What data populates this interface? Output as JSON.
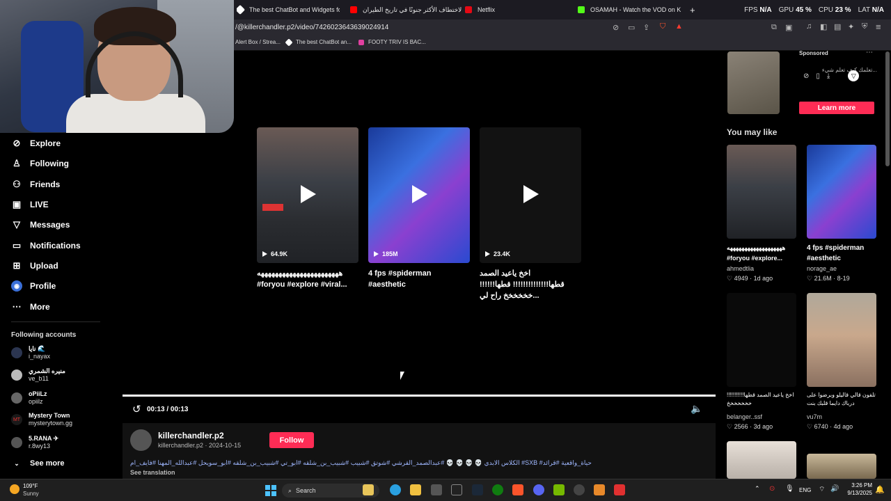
{
  "browser": {
    "tabs": [
      {
        "label": "The best ChatBot and Widgets for Ki",
        "color": "#ffffff"
      },
      {
        "label": "الاختطاف الأكثر جنونًا في تاريخ الطيران",
        "color": "#ff0000"
      },
      {
        "label": "Netflix",
        "color": "#e50914"
      },
      {
        "label": "OSAMAH - Watch the VOD on Kick",
        "color": "#53fc18"
      }
    ],
    "new_tab": "+",
    "url": "/@killerchandler.p2/video/7426023643639024914",
    "bookmarks": [
      "Alert Box / Strea...",
      "The best ChatBot an...",
      "FOOTY TRIV IS BAC..."
    ]
  },
  "overlay_stats": [
    {
      "label": "FPS",
      "value": "N/A"
    },
    {
      "label": "GPU",
      "value": "45 %"
    },
    {
      "label": "CPU",
      "value": "23 %"
    },
    {
      "label": "LAT",
      "value": "N/A"
    }
  ],
  "nav": [
    {
      "label": "Explore",
      "icon": "compass-icon"
    },
    {
      "label": "Following",
      "icon": "person-follow-icon"
    },
    {
      "label": "Friends",
      "icon": "friends-icon"
    },
    {
      "label": "LIVE",
      "icon": "live-tv-icon"
    },
    {
      "label": "Messages",
      "icon": "messages-icon"
    },
    {
      "label": "Notifications",
      "icon": "notifications-icon"
    },
    {
      "label": "Upload",
      "icon": "upload-icon"
    },
    {
      "label": "Profile",
      "icon": "profile-icon"
    },
    {
      "label": "More",
      "icon": "more-dots-icon"
    }
  ],
  "following_accounts": {
    "title": "Following accounts",
    "accounts": [
      {
        "name": "نايا 🌊",
        "handle": "i_nayax"
      },
      {
        "name": "منيره الشمري",
        "handle": "ve_b11"
      },
      {
        "name": "oPiiLz",
        "handle": "opiilz"
      },
      {
        "name": "Mystery Town",
        "handle": "mysterytown.gg"
      },
      {
        "name": "5.RANA ✈",
        "handle": "r.8wy13"
      }
    ],
    "see_more": "See more"
  },
  "grid_videos": [
    {
      "views": "64.9K",
      "caption": "هههههههههههههههههههههههه #foryou #explore #viral..."
    },
    {
      "views": "185M",
      "caption": "4 fps #spiderman #aesthetic"
    },
    {
      "views": "23.4K",
      "caption": "اخخ ياعيد الصمد قطها!!!!!!!!!!!!!! قطها!!!!!!خخخخخخ راح لي..."
    }
  ],
  "player": {
    "time": "00:13 / 00:13",
    "progress": 1.0
  },
  "video_info": {
    "username": "killerchandler.p2",
    "sub": "killerchandler.p2 · 2024-10-15",
    "follow": "Follow",
    "description": "الكلاس الابدي 💀 💀 💀 💀 #عبدالصمد_القرشي #شوتق #شبيب #شبيب_بن_شلقه #ابو_تي #شبيب_بن_شلقه #ابو_سويحل #عبدالله_المهنا #فايف_ام #SXB #حياة_واقعية #قرائد",
    "see_translation": "See translation"
  },
  "sponsored": {
    "label": "Sponsored",
    "text": "...تعلمك كيف تعلم شيء",
    "cta": "Learn more"
  },
  "you_may_like": {
    "title": "You may like",
    "items": [
      {
        "caption": "هههههههههههههههههههه #foryou #explore...",
        "user": "ahmedtlia",
        "likes": "4949",
        "ago": "1d ago"
      },
      {
        "caption": "4 fps #spiderman #aesthetic",
        "user": "norage_ae",
        "likes": "21.6M",
        "ago": "8-19"
      },
      {
        "caption": "اخخ ياعيد الصمد قطها!!!!!!!!!!!خخخخخخخ",
        "user": "belanger..ssf",
        "likes": "2566",
        "ago": "3d ago"
      },
      {
        "caption": "تلفون قالي قاليلو وبرضوا على درباك دايما قلبك بنت",
        "user": "vu7m",
        "likes": "6740",
        "ago": "4d ago"
      }
    ]
  },
  "taskbar": {
    "weather_temp": "109°F",
    "weather_desc": "Sunny",
    "search": "Search",
    "lang": "ENG",
    "time": "3:26 PM",
    "date": "9/13/2025"
  }
}
